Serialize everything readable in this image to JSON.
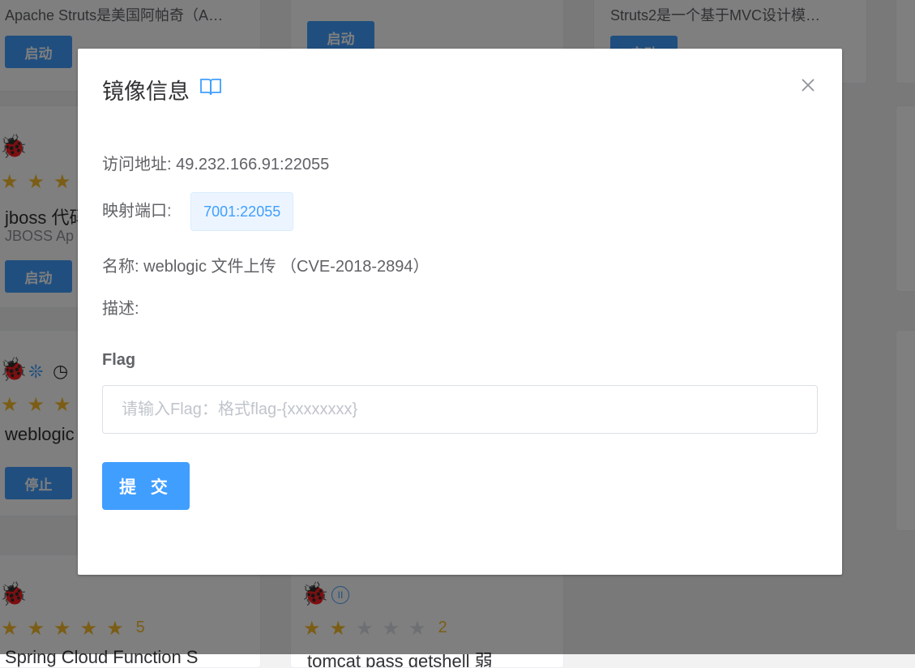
{
  "background": {
    "cards": [
      {
        "desc": "Apache Struts是美国阿帕奇（A…",
        "button": "启动"
      },
      {
        "button": "启动"
      },
      {
        "desc": "Struts2是一个基于MVC设计模…",
        "button": "启动"
      },
      {
        "title": "jboss 代码",
        "sub": "JBOSS Ap",
        "button": "启动",
        "rating": 3
      },
      {
        "title": "weblogic",
        "button": "停止",
        "rating": 3
      },
      {
        "rating": 5,
        "rating_text": "5",
        "title": "Spring Cloud Function S"
      },
      {
        "rating": 2,
        "rating_text": "2",
        "title": "tomcat pass getshell 弱"
      }
    ],
    "icons": [
      "bug-icon",
      "spinner-icon",
      "clock-icon",
      "pause-icon"
    ]
  },
  "dialog": {
    "title": "镜像信息",
    "title_icon": "book-icon",
    "close_icon": "close-icon",
    "address_label": "访问地址:",
    "address_value": "49.232.166.91:22055",
    "port_label": "映射端口:",
    "port_tag": "7001:22055",
    "name_label": "名称:",
    "name_value": "weblogic 文件上传 （CVE-2018-2894）",
    "desc_label": "描述:",
    "desc_value": "",
    "flag_label": "Flag",
    "flag_placeholder": "请输入Flag：格式flag-{xxxxxxxx}",
    "flag_value": "",
    "submit_label": "提 交"
  },
  "colors": {
    "primary": "#409eff",
    "star": "#f7ba2a",
    "tag_bg": "#ecf5ff"
  }
}
